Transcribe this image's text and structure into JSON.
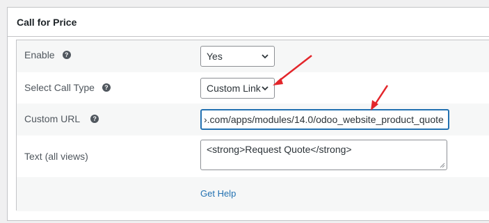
{
  "panel": {
    "title": "Call for Price"
  },
  "fields": {
    "enable": {
      "label": "Enable",
      "help_icon": "question-circle-icon",
      "value": "Yes"
    },
    "call_type": {
      "label": "Select Call Type",
      "help_icon": "question-circle-icon",
      "value": "Custom Link"
    },
    "custom_url": {
      "label": "Custom URL",
      "help_icon": "question-circle-icon",
      "value": "›.com/apps/modules/14.0/odoo_website_product_quote"
    },
    "text_all_views": {
      "label": "Text (all views)",
      "value": "<strong>Request Quote</strong>"
    }
  },
  "help_link": "Get Help",
  "colors": {
    "accent": "#2271b1",
    "annotation_arrow": "#e3262b"
  },
  "annotations": [
    "red-arrow-to-call-type-select",
    "red-arrow-to-custom-url-input"
  ]
}
